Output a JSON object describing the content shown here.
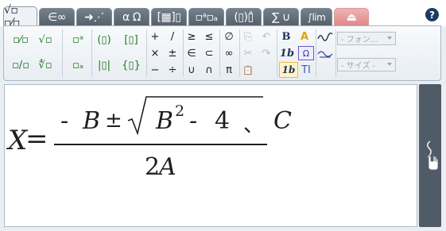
{
  "tabs": [
    {
      "label": "√▫ ▫⁄▫",
      "active": true
    },
    {
      "label": "∈∞"
    },
    {
      "label": "➜⋰"
    },
    {
      "label": "α Ω"
    },
    {
      "label": "[▦]▯"
    },
    {
      "label": "▫ᵃ▫ₐ"
    },
    {
      "label": "(▯)▯̂"
    },
    {
      "label": "∑ ∪"
    },
    {
      "label": "∫lim"
    },
    {
      "label": "⏏",
      "disabled": true
    }
  ],
  "help_label": "?",
  "ribbon": {
    "templates": [
      "▫⁄▫",
      "√▫",
      "▫ᵃ",
      "(▯)",
      "[▯]",
      "▫/▫",
      "∜▫",
      "▫ₐ",
      "|▯|",
      "{▯}"
    ],
    "operators": [
      "+",
      "/",
      "×",
      "±",
      "−",
      "÷"
    ],
    "relations": [
      "≥",
      "≤",
      "∈",
      "⊂",
      "∪",
      "∩"
    ],
    "misc": [
      "∅",
      "∞",
      "π"
    ],
    "edit": {
      "copy": "⎘",
      "undo": "↶",
      "cut": "✂",
      "redo": "↷",
      "paste": "📋"
    },
    "format": {
      "bold": "B",
      "color": "A",
      "italic": "1b",
      "omega": "Ω",
      "slash": "1b",
      "text": "TI"
    },
    "font_placeholder": "- フォン… ",
    "size_placeholder": "- サイズ - "
  },
  "formula": {
    "lhs": "X",
    "equals": "=",
    "num_minus": "-",
    "num_B": "B",
    "pm": "±",
    "rad_B": "B",
    "rad_exp": "2",
    "rad_minus": "-",
    "rad_four": "4",
    "rad_comma": "、",
    "rad_C": "C",
    "den_two": "2",
    "den_A": "A"
  },
  "side_icon": "hand-icon"
}
